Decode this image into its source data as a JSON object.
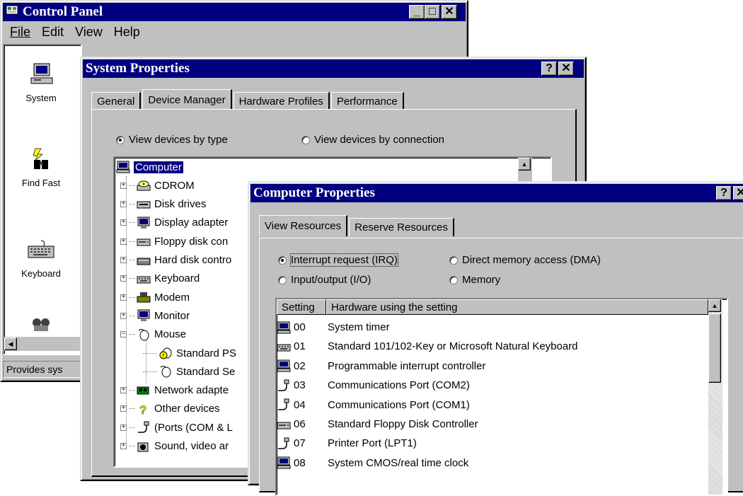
{
  "control_panel": {
    "title": "Control Panel",
    "menu": [
      "File",
      "Edit",
      "View",
      "Help"
    ],
    "icons": [
      {
        "label": "System",
        "icon": "computer-icon"
      },
      {
        "label": "Find Fast",
        "icon": "binoculars-icon"
      },
      {
        "label": "Keyboard",
        "icon": "keyboard-icon"
      },
      {
        "label": "",
        "icon": "joystick-icon"
      }
    ],
    "status": "Provides sys"
  },
  "system_props": {
    "title": "System Properties",
    "tabs": [
      "General",
      "Device Manager",
      "Hardware Profiles",
      "Performance"
    ],
    "active_tab": "Device Manager",
    "view_by_type": "View devices by type",
    "view_by_connection": "View devices by connection",
    "tree": [
      {
        "label": "Computer",
        "icon": "computer-icon",
        "level": 0,
        "expander": "",
        "selected": true
      },
      {
        "label": "CDROM",
        "icon": "cdrom-icon",
        "level": 1,
        "expander": "+"
      },
      {
        "label": "Disk drives",
        "icon": "disk-drive-icon",
        "level": 1,
        "expander": "+"
      },
      {
        "label": "Display adapter",
        "icon": "monitor-icon",
        "level": 1,
        "expander": "+"
      },
      {
        "label": "Floppy disk con",
        "icon": "floppy-icon",
        "level": 1,
        "expander": "+"
      },
      {
        "label": "Hard disk contro",
        "icon": "hard-disk-icon",
        "level": 1,
        "expander": "+"
      },
      {
        "label": "Keyboard",
        "icon": "keyboard-icon",
        "level": 1,
        "expander": "+"
      },
      {
        "label": "Modem",
        "icon": "modem-icon",
        "level": 1,
        "expander": "+"
      },
      {
        "label": "Monitor",
        "icon": "monitor-icon",
        "level": 1,
        "expander": "+"
      },
      {
        "label": "Mouse",
        "icon": "mouse-icon",
        "level": 1,
        "expander": "−"
      },
      {
        "label": "Standard PS",
        "icon": "mouse-warning-icon",
        "level": 2,
        "expander": ""
      },
      {
        "label": "Standard Se",
        "icon": "mouse-icon",
        "level": 2,
        "expander": ""
      },
      {
        "label": "Network adapte",
        "icon": "network-card-icon",
        "level": 1,
        "expander": "+"
      },
      {
        "label": "Other devices",
        "icon": "question-icon",
        "level": 1,
        "expander": "+"
      },
      {
        "label": "(Ports (COM & L",
        "icon": "port-icon",
        "level": 1,
        "expander": "+"
      },
      {
        "label": "Sound, video ar",
        "icon": "sound-icon",
        "level": 1,
        "expander": "+"
      }
    ]
  },
  "computer_props": {
    "title": "Computer Properties",
    "tabs": [
      "View Resources",
      "Reserve Resources"
    ],
    "active_tab": "View Resources",
    "radios": [
      {
        "label": "Interrupt request (IRQ)",
        "checked": true
      },
      {
        "label": "Direct memory access (DMA)",
        "checked": false
      },
      {
        "label": "Input/output (I/O)",
        "checked": false
      },
      {
        "label": "Memory",
        "checked": false
      }
    ],
    "list_headers": [
      "Setting",
      "Hardware using the setting"
    ],
    "rows": [
      {
        "setting": "00",
        "hardware": "System timer",
        "icon": "computer-icon"
      },
      {
        "setting": "01",
        "hardware": "Standard 101/102-Key or Microsoft Natural Keyboard",
        "icon": "keyboard-icon"
      },
      {
        "setting": "02",
        "hardware": "Programmable interrupt controller",
        "icon": "computer-icon"
      },
      {
        "setting": "03",
        "hardware": "Communications Port (COM2)",
        "icon": "port-icon"
      },
      {
        "setting": "04",
        "hardware": "Communications Port (COM1)",
        "icon": "port-icon"
      },
      {
        "setting": "06",
        "hardware": "Standard Floppy Disk Controller",
        "icon": "floppy-icon"
      },
      {
        "setting": "07",
        "hardware": "Printer Port (LPT1)",
        "icon": "port-icon"
      },
      {
        "setting": "08",
        "hardware": "System CMOS/real time clock",
        "icon": "computer-icon"
      }
    ]
  },
  "colors": {
    "titlebar": "#000080",
    "face": "#c0c0c0",
    "highlight": "#000080"
  }
}
